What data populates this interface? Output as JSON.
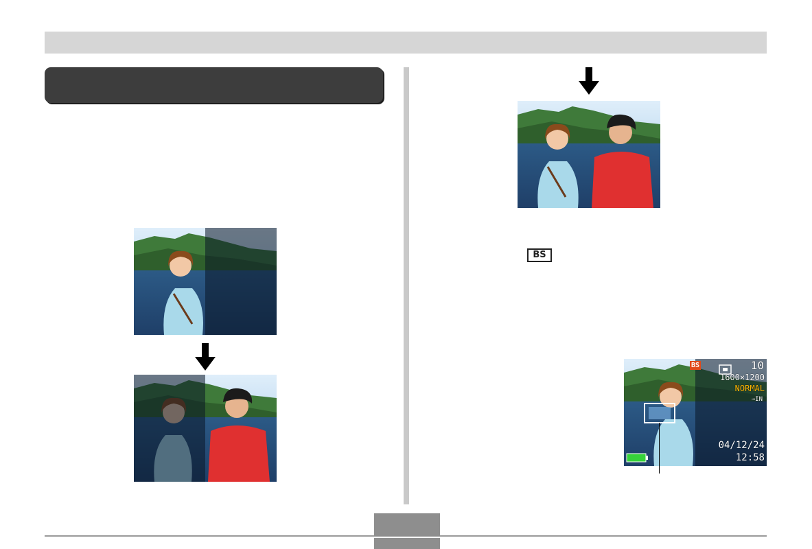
{
  "page": {
    "colors": {
      "band": "#d6d6d6",
      "heading": "#3d3d3d",
      "divider": "#c9c9c9",
      "tab": "#8e8e8e"
    }
  },
  "left": {
    "photo_before": {
      "description_icon": "photo-woman-half-icon"
    },
    "photo_after": {
      "description_icon": "photo-man-half-icon"
    }
  },
  "right": {
    "photo_combined": {
      "description_icon": "photo-couple-icon"
    },
    "bs_icon_label": "BS",
    "lcd": {
      "mode_badge": "BS",
      "shots_remaining": "10",
      "resolution": "1600×1200",
      "quality": "NORMAL",
      "date": "04/12/24",
      "time": "12:58",
      "colors": {
        "badge": "#e04a1a",
        "quality": "#ffb400",
        "battery": "#36d23a"
      }
    }
  }
}
